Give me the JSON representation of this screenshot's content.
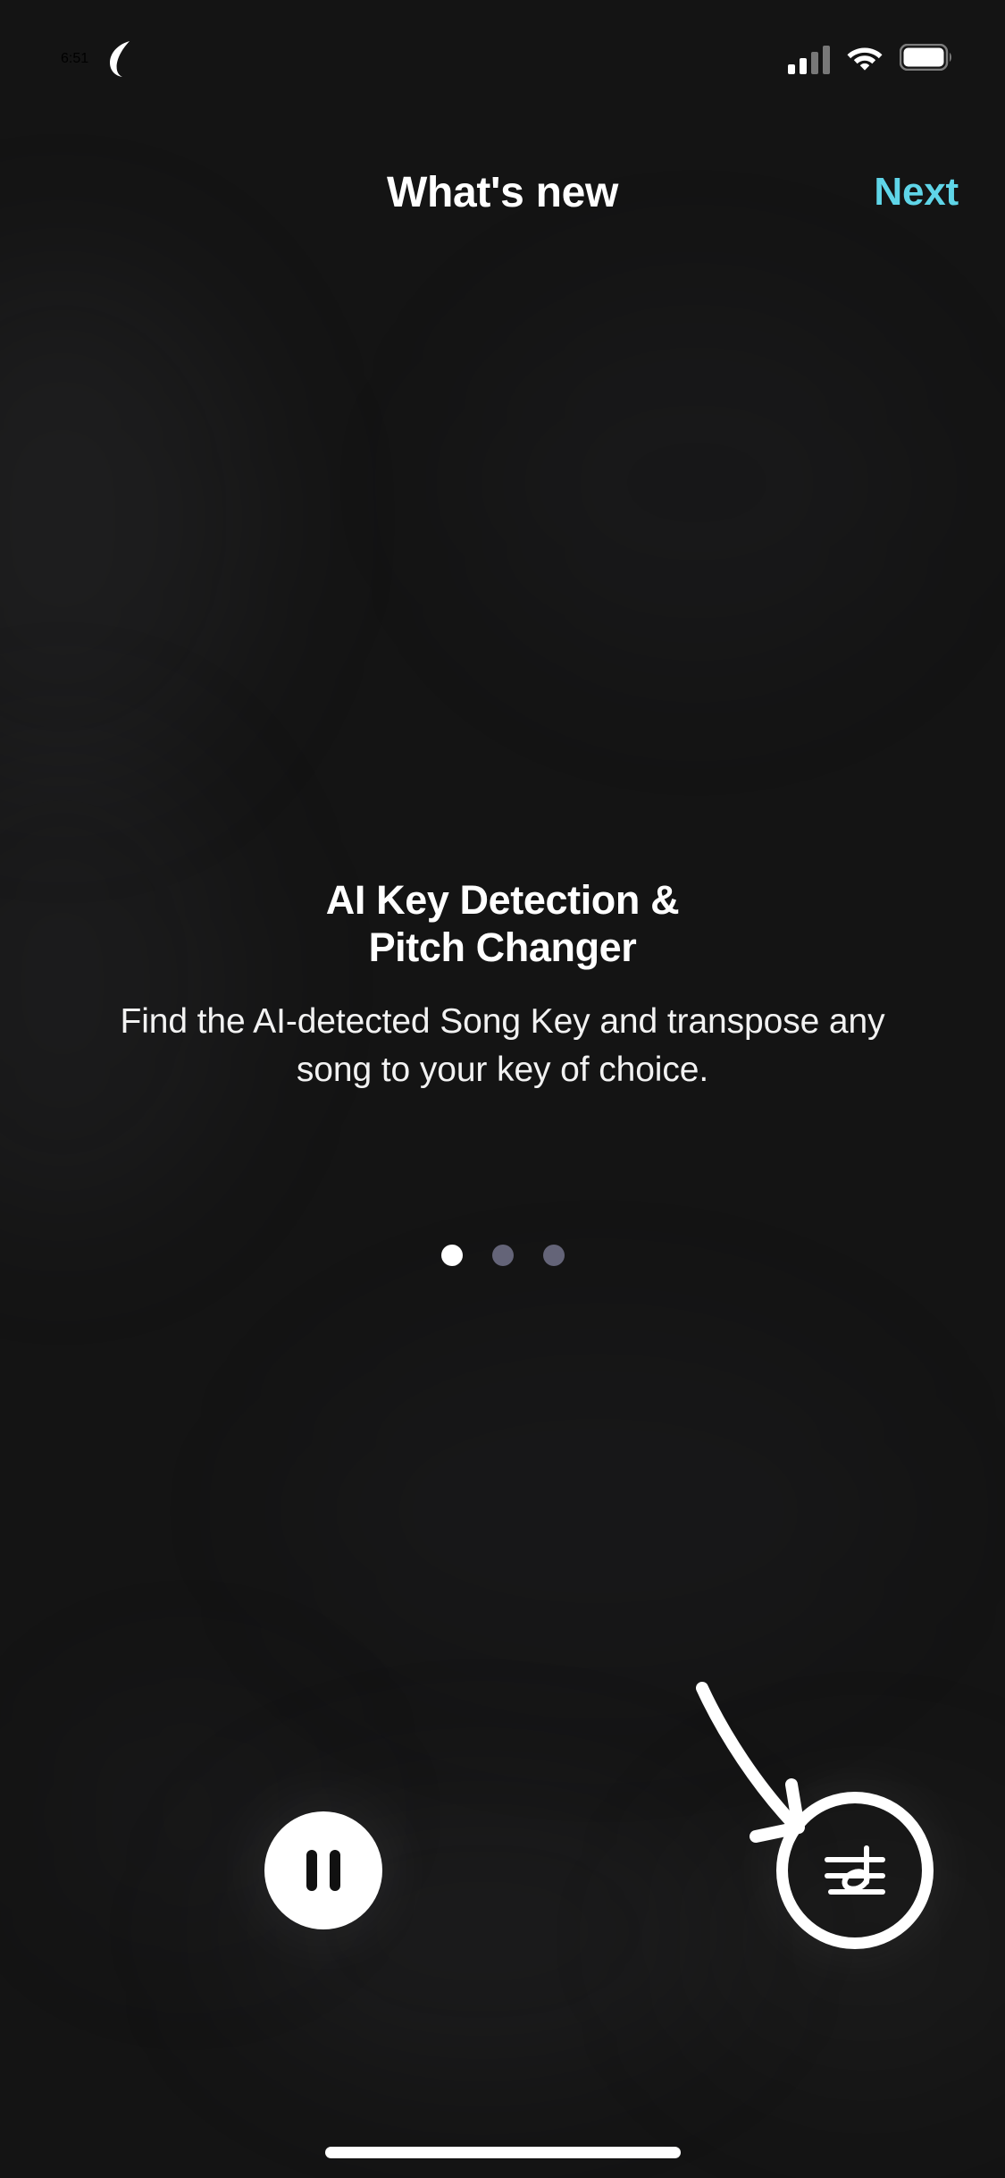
{
  "status_bar": {
    "time": "6:51",
    "dnd_icon": "crescent-moon-icon",
    "signal_icon": "cellular-signal-icon",
    "signal_bars_filled": 2,
    "signal_bars_total": 4,
    "wifi_icon": "wifi-icon",
    "battery_icon": "battery-full-icon"
  },
  "header": {
    "title": "What's new",
    "next_label": "Next"
  },
  "hero": {
    "title": "AI Key Detection &\nPitch Changer",
    "subtitle": "Find the AI-detected Song Key and transpose any song to your key of choice."
  },
  "pager": {
    "total": 3,
    "active_index": 0
  },
  "controls": {
    "pause_label": "Pause",
    "pause_icon": "pause-icon",
    "key_button_label": "Key",
    "key_button_icon": "music-note-staff-icon",
    "hint_arrow_icon": "curved-arrow-down-right-icon"
  },
  "system": {
    "home_indicator": "home-indicator"
  },
  "colors": {
    "background": "#141414",
    "accent": "#5FD5E8",
    "text_primary": "#ffffff",
    "text_secondary": "#f2f2f2",
    "dot_inactive": "#646478",
    "dot_active": "#ffffff",
    "control_fill": "#ffffff"
  }
}
